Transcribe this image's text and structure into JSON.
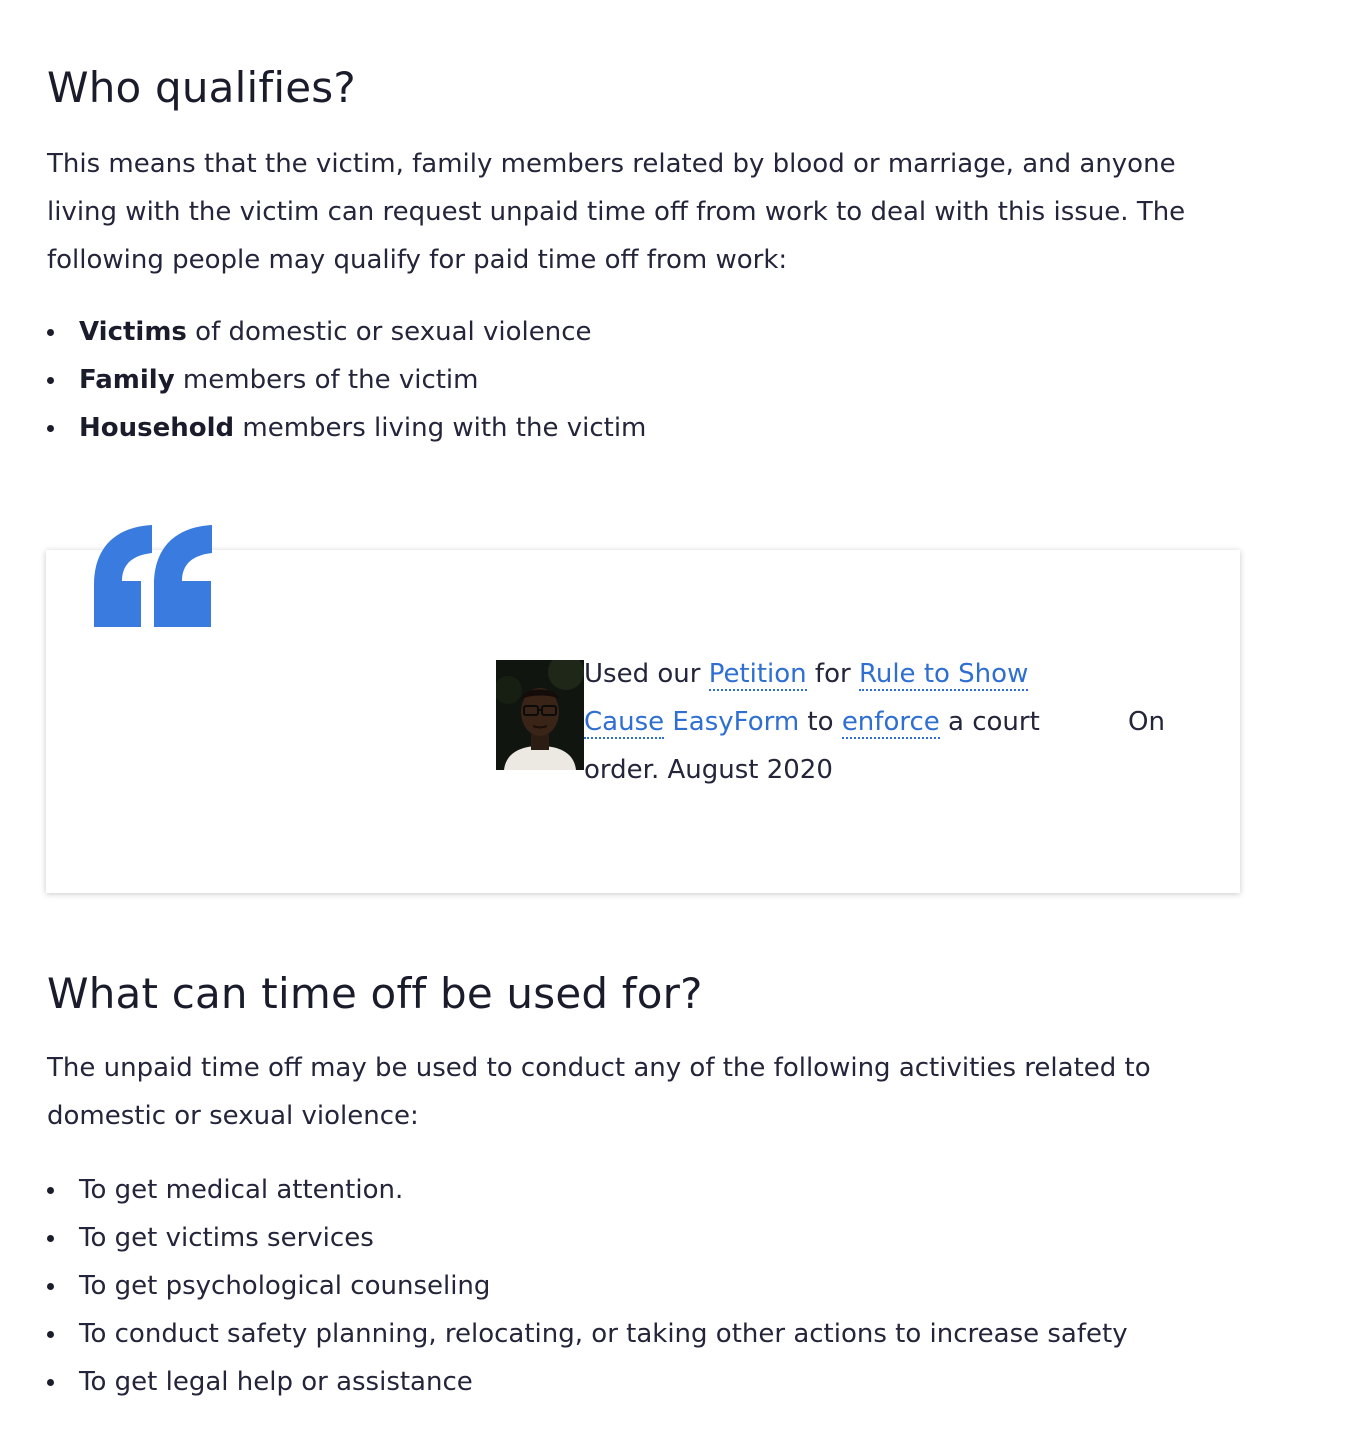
{
  "qualifies": {
    "heading": "Who qualifies?",
    "intro": " This means that the victim, family members related by blood or marriage, and anyone living with the victim can request unpaid time off from work to deal with this issue. The following people may qualify for paid time off from work:",
    "items": [
      {
        "bold": "Victims",
        "rest": " of domestic or sexual violence"
      },
      {
        "bold": "Family",
        "rest": " members of the victim"
      },
      {
        "bold": "Household",
        "rest": " members living with the victim"
      }
    ]
  },
  "testimonial": {
    "icon": "quote-icon",
    "accent_color": "#3a7be0",
    "avatar_icon": "person-avatar",
    "text_before": "Used our ",
    "link_petition": "Petition",
    "text_for": " for ",
    "link_rule": "Rule to Show Cause",
    "link_easyform": " EasyForm",
    "text_to": " to ",
    "link_enforce": "enforce",
    "text_after": " a court order. August 2020",
    "on_label": "On"
  },
  "usage": {
    "heading": "What can time off be used for?",
    "intro": "The unpaid time off may be used to conduct any of the following activities related to domestic or sexual violence:",
    "items": [
      "To get medical attention.",
      "To get victims services",
      "To get psychological counseling",
      "To conduct safety planning, relocating, or taking other actions to increase safety",
      "To get legal help or assistance"
    ]
  }
}
